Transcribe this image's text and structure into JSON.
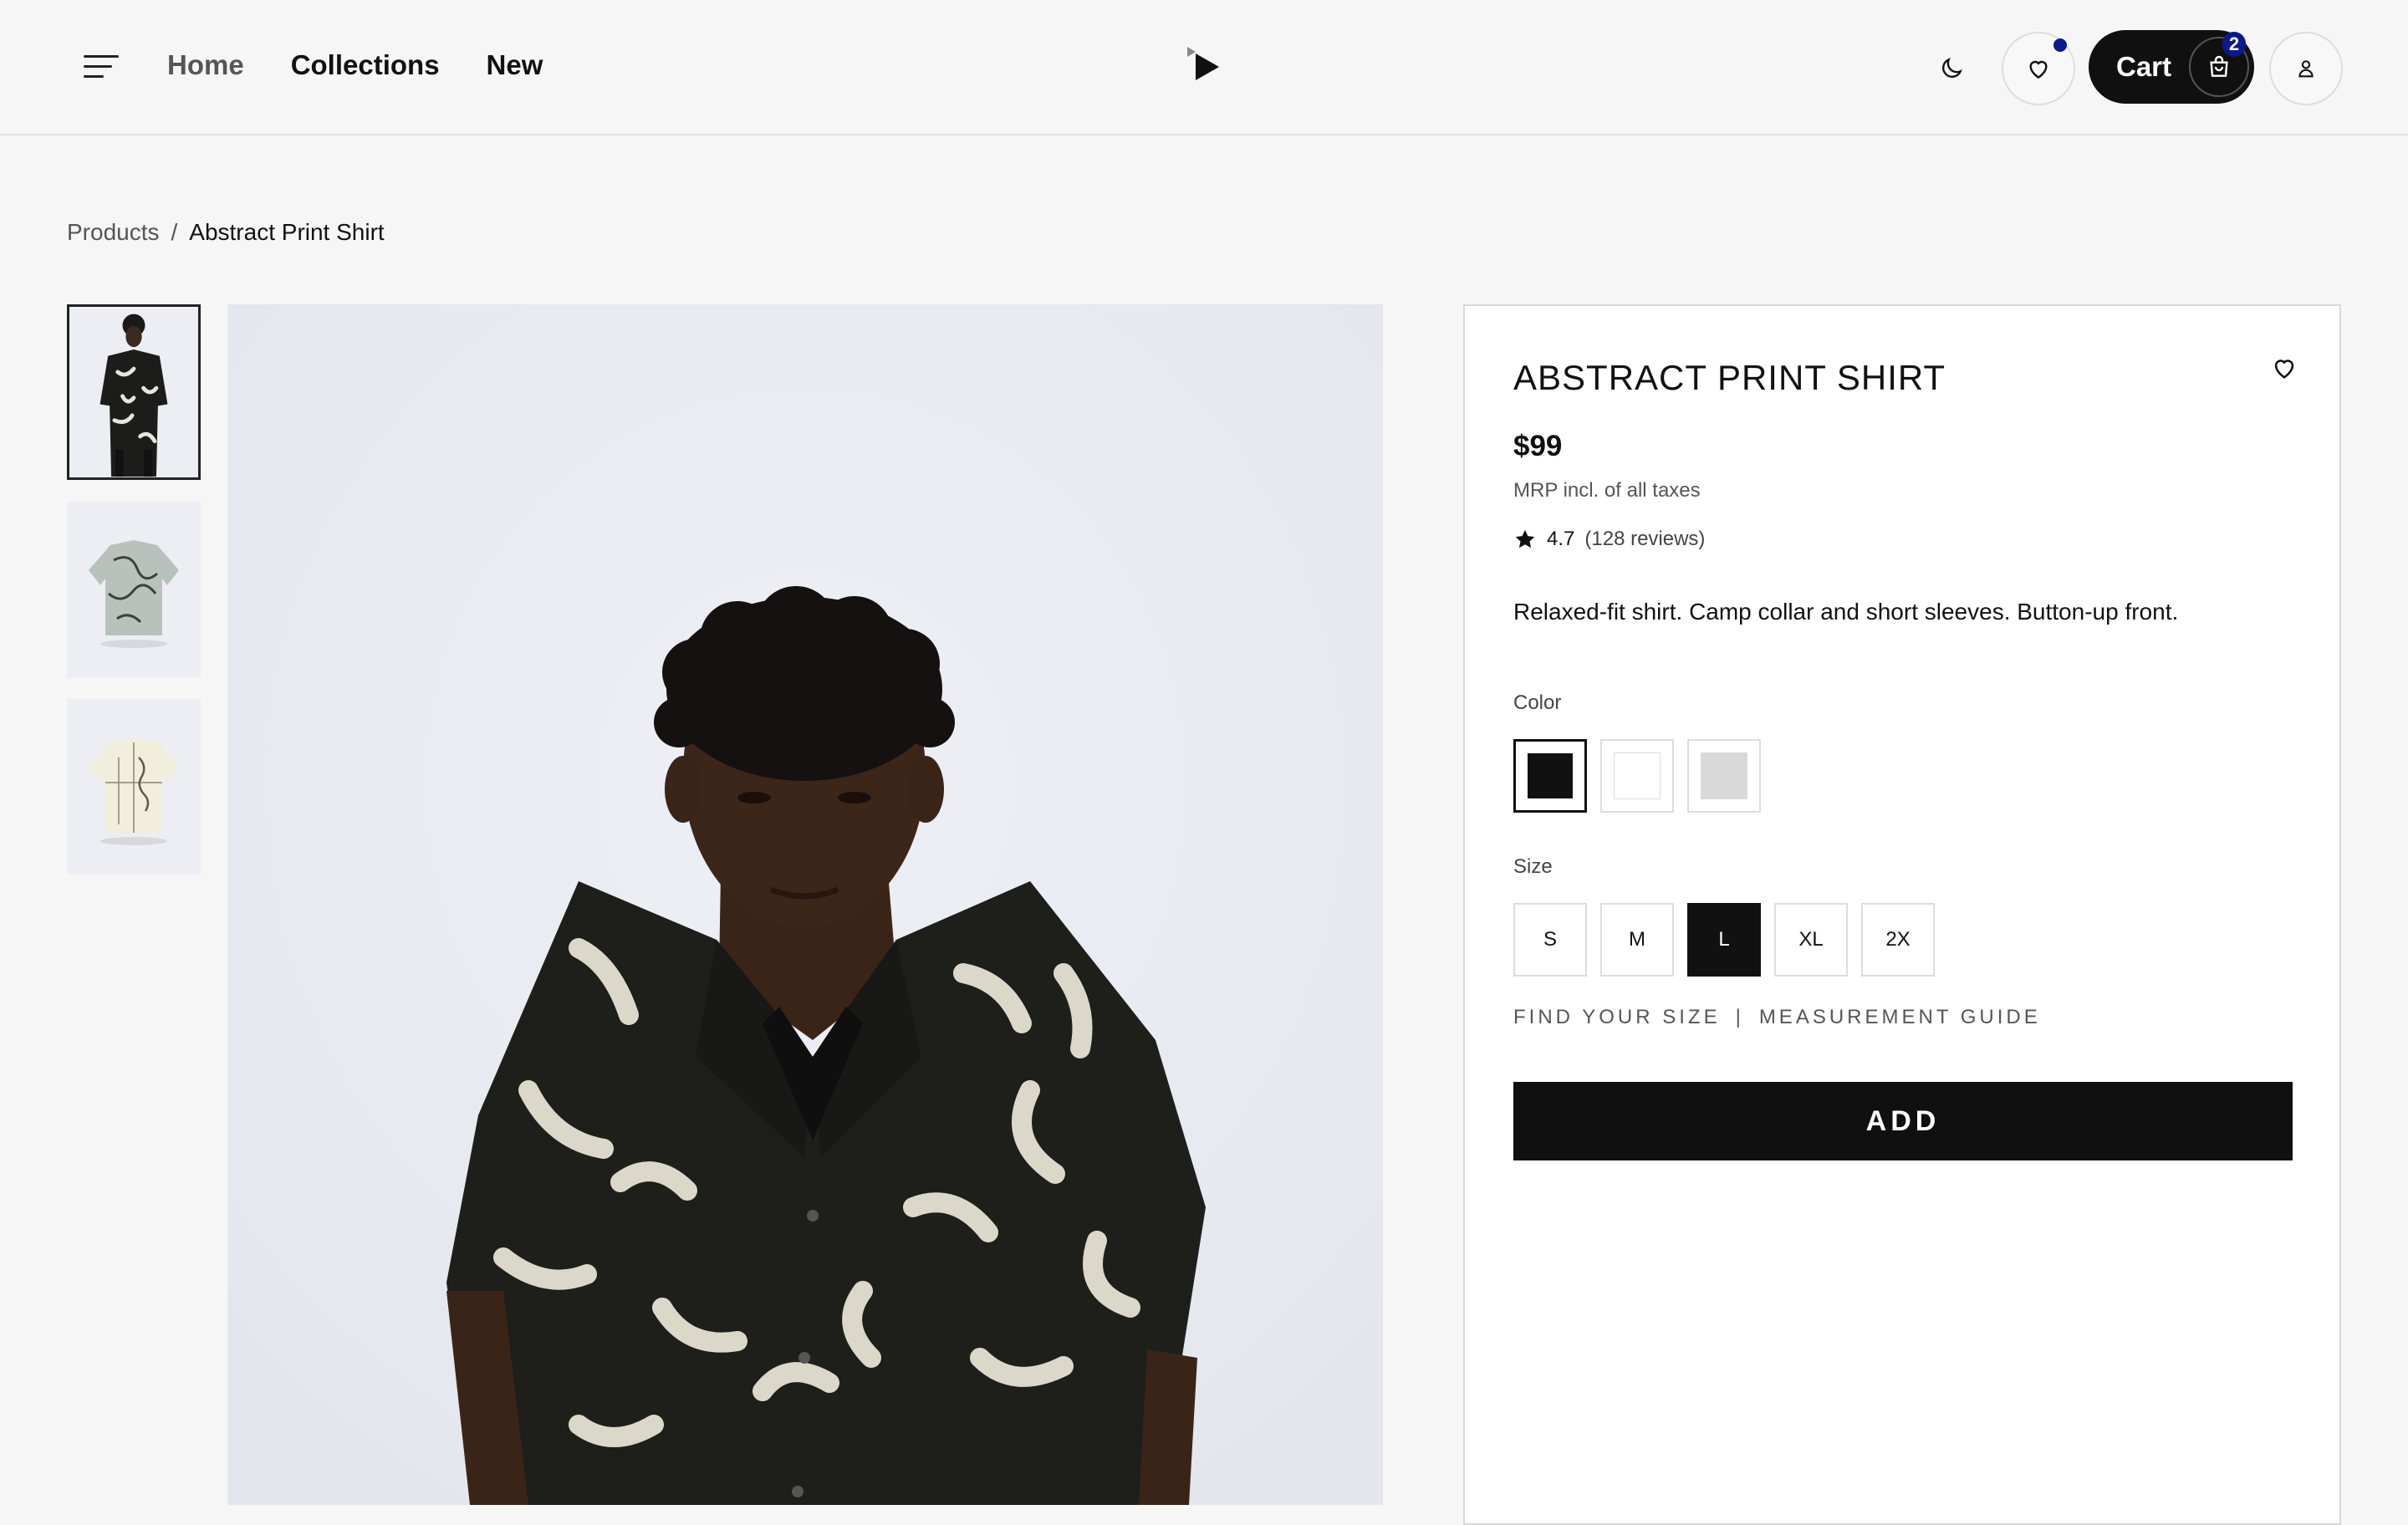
{
  "header": {
    "nav": [
      {
        "label": "Home"
      },
      {
        "label": "Collections"
      },
      {
        "label": "New"
      }
    ],
    "cart": {
      "label": "Cart",
      "count": "2"
    },
    "accent_color": "#0a1a8a"
  },
  "breadcrumb": {
    "parent": "Products",
    "separator": "/",
    "current": "Abstract Print Shirt"
  },
  "gallery": {
    "thumbnails": [
      {
        "icon": "model-front-photo",
        "active": true
      },
      {
        "icon": "shirt-grey-print-photo",
        "active": false
      },
      {
        "icon": "shirt-cream-print-photo",
        "active": false
      }
    ]
  },
  "product": {
    "title": "ABSTRACT PRINT SHIRT",
    "price": "$99",
    "tax_note": "MRP incl. of all taxes",
    "rating": "4.7",
    "reviews": "(128 reviews)",
    "description": "Relaxed-fit shirt. Camp collar and short sleeves. Button-up front.",
    "color_label": "Color",
    "colors": [
      {
        "hex": "#111111",
        "selected": true
      },
      {
        "hex": "#ffffff",
        "selected": false
      },
      {
        "hex": "#d9d9d9",
        "selected": false
      }
    ],
    "size_label": "Size",
    "sizes": [
      {
        "label": "S",
        "selected": false
      },
      {
        "label": "M",
        "selected": false
      },
      {
        "label": "L",
        "selected": true
      },
      {
        "label": "XL",
        "selected": false
      },
      {
        "label": "2X",
        "selected": false
      }
    ],
    "find_size": "FIND YOUR SIZE",
    "size_links_separator": "|",
    "measurement_guide": "MEASUREMENT GUIDE",
    "add_label": "ADD"
  }
}
